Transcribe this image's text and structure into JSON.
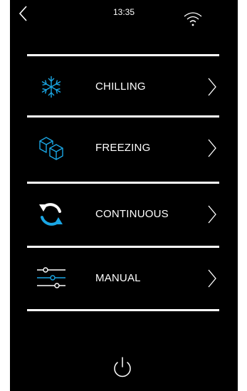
{
  "status_bar": {
    "time": "13:35",
    "back_icon": "chevron-left-icon",
    "wifi_icon": "wifi-icon"
  },
  "menu": {
    "items": [
      {
        "label": "CHILLING",
        "icon": "snowflake-icon"
      },
      {
        "label": "FREEZING",
        "icon": "ice-cubes-icon"
      },
      {
        "label": "CONTINUOUS",
        "icon": "cycle-arrows-icon"
      },
      {
        "label": "MANUAL",
        "icon": "sliders-icon"
      }
    ],
    "chevron_icon": "chevron-right-icon"
  },
  "footer": {
    "power_icon": "power-icon"
  },
  "colors": {
    "background": "#000000",
    "text": "#ffffff",
    "icon_accent": "#1aa6e4",
    "icon_outline": "#ffffff",
    "frame": "#ffffff"
  }
}
